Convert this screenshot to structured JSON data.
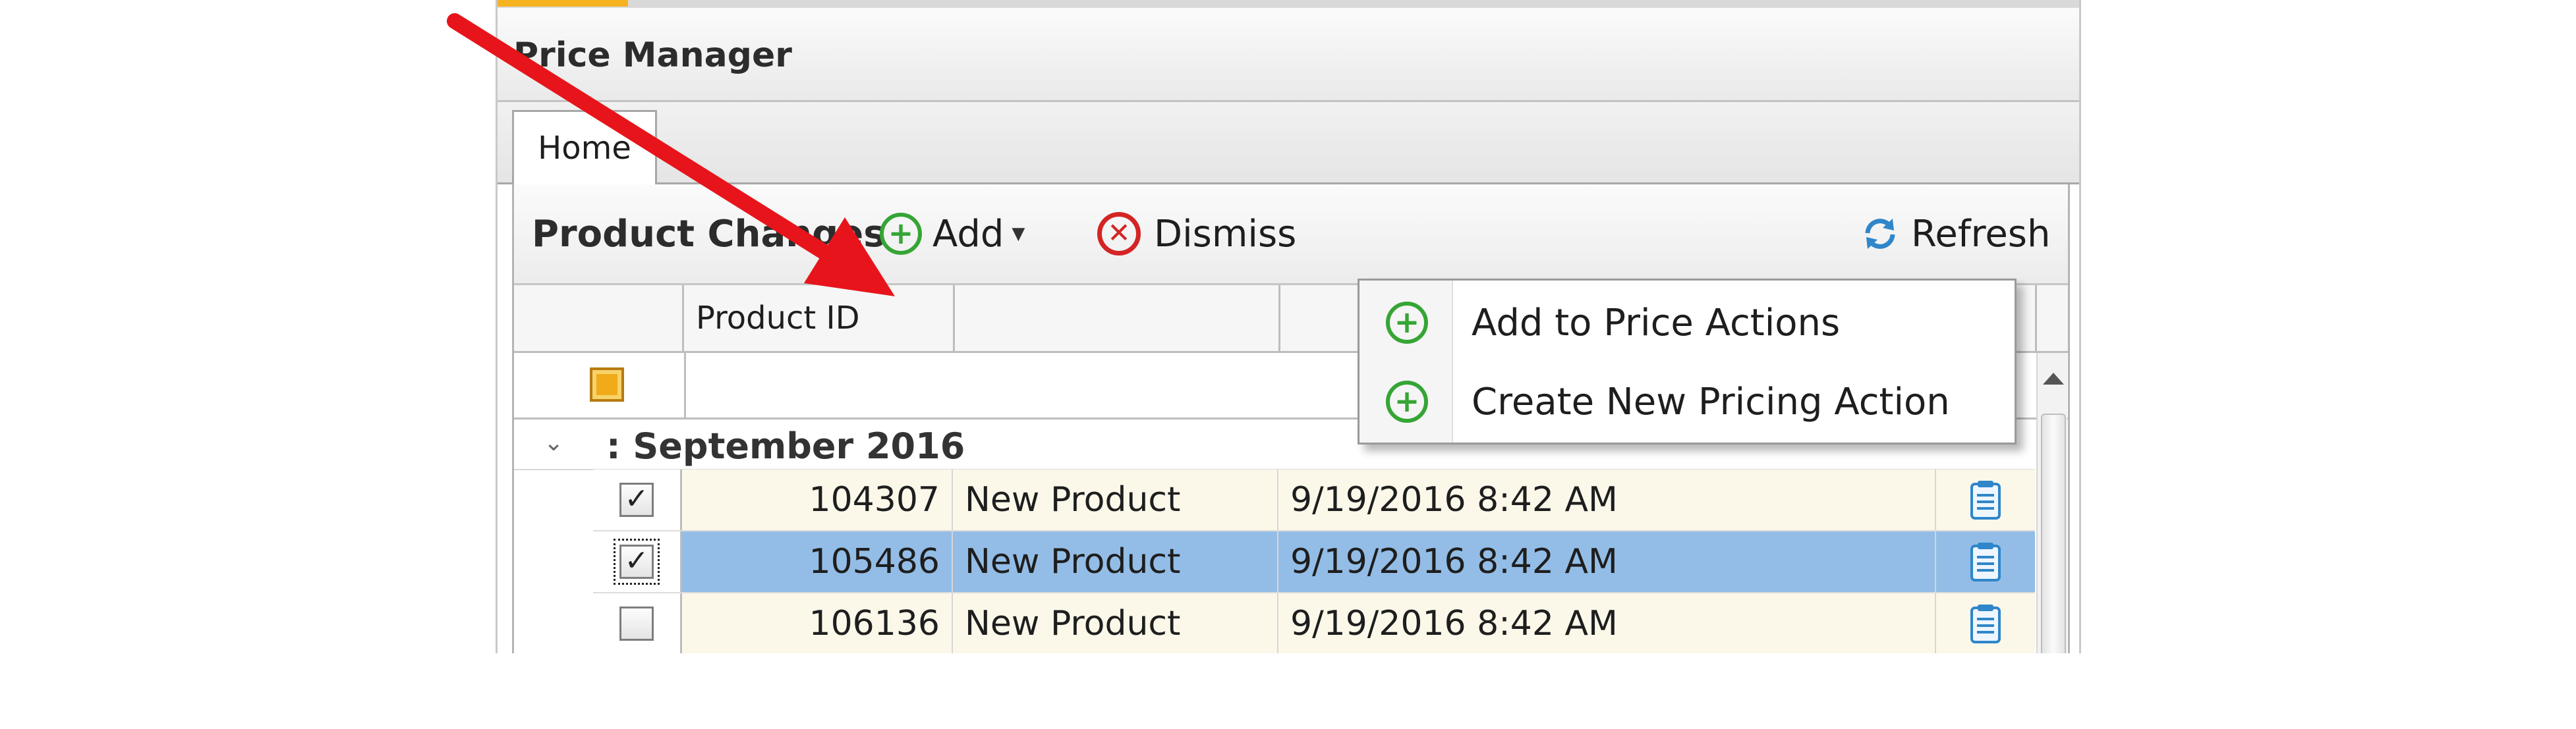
{
  "window": {
    "title": "Price Manager"
  },
  "tabs": [
    {
      "label": "Home",
      "active": true
    }
  ],
  "toolbar": {
    "title": "Product Changes",
    "add_label": "Add",
    "dismiss_label": "Dismiss",
    "refresh_label": "Refresh"
  },
  "grid": {
    "columns": [
      "",
      "Product ID",
      "",
      "",
      ""
    ],
    "group_label": ": September 2016",
    "rows": [
      {
        "checked": true,
        "selected": false,
        "id": "104307",
        "desc": "New Product",
        "date": "9/19/2016 8:42 AM"
      },
      {
        "checked": true,
        "selected": true,
        "id": "105486",
        "desc": "New Product",
        "date": "9/19/2016 8:42 AM"
      },
      {
        "checked": false,
        "selected": false,
        "id": "106136",
        "desc": "New Product",
        "date": "9/19/2016 8:42 AM"
      }
    ]
  },
  "add_menu": {
    "items": [
      {
        "label": "Add to Price Actions",
        "icon": "add-circle-icon"
      },
      {
        "label": "Create New Pricing Action",
        "icon": "add-circle-icon"
      }
    ]
  },
  "icons": {
    "add": "add-circle-icon",
    "dismiss": "dismiss-circle-icon",
    "refresh": "refresh-icon",
    "filter": "filter-icon",
    "note": "notepad-icon",
    "collapse": "chevron-down-icon"
  },
  "colors": {
    "add_green": "#35a535",
    "dismiss_red": "#d42424",
    "selected_row": "#93bde6",
    "annotation_arrow": "#e8141b"
  }
}
